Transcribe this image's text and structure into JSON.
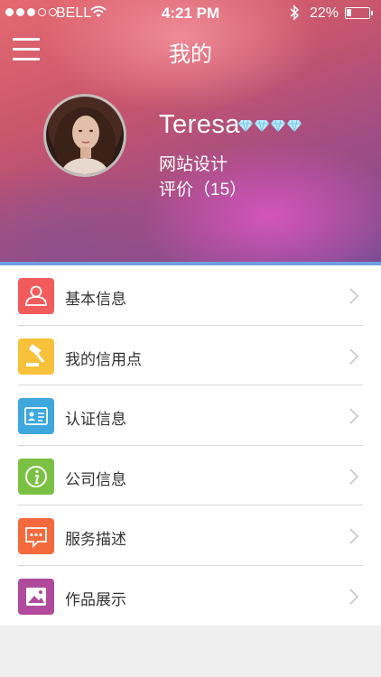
{
  "status_bar": {
    "carrier": "BELL",
    "time": "4:21 PM",
    "battery_text": "22%",
    "battery_level": 0.22
  },
  "header": {
    "title": "我的",
    "menu_icon": "hamburger-icon"
  },
  "profile": {
    "name": "Teresa",
    "job": "网站设计",
    "rating": "评价（15）",
    "diamond_count": 4
  },
  "menu_items": [
    {
      "label": "基本信息",
      "icon": "user-icon",
      "color": "#f25b5b"
    },
    {
      "label": "我的信用点",
      "icon": "gavel-icon",
      "color": "#f7c13b"
    },
    {
      "label": "认证信息",
      "icon": "id-card-icon",
      "color": "#3ea7dd"
    },
    {
      "label": "公司信息",
      "icon": "info-icon",
      "color": "#7ac143"
    },
    {
      "label": "服务描述",
      "icon": "chat-icon",
      "color": "#f46a3c"
    },
    {
      "label": "作品展示",
      "icon": "image-icon",
      "color": "#b04a9b"
    }
  ]
}
